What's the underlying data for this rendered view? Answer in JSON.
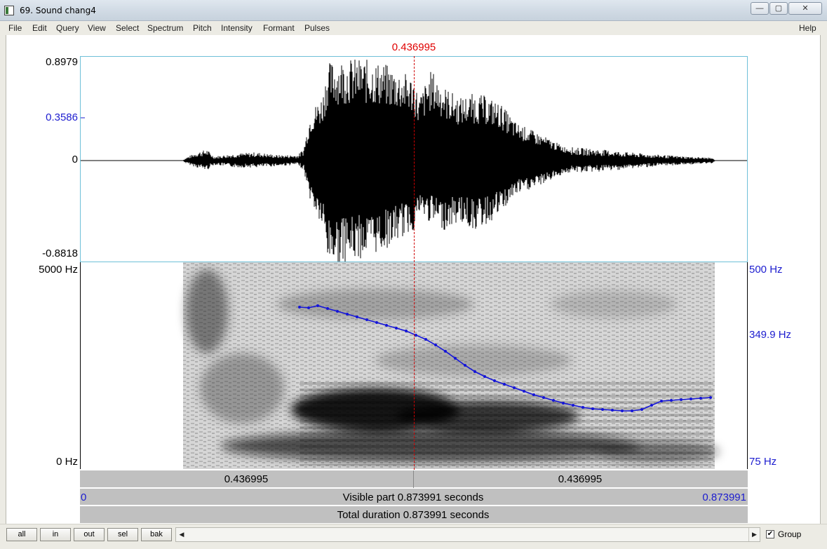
{
  "window": {
    "title": "69. Sound chang4",
    "min_glyph": "—",
    "max_glyph": "▢",
    "close_glyph": "✕"
  },
  "menu": {
    "items": [
      "File",
      "Edit",
      "Query",
      "View",
      "Select",
      "Spectrum",
      "Pitch",
      "Intensity",
      "Formant",
      "Pulses"
    ],
    "help": "Help"
  },
  "cursor": {
    "time_label": "0.436995"
  },
  "waveform": {
    "y_max": "0.8979",
    "y_value": "0.3586",
    "y_zero": "0",
    "y_min": "-0.8818"
  },
  "spectrogram": {
    "freq_max": "5000 Hz",
    "freq_min": "0 Hz"
  },
  "pitch": {
    "max": "500 Hz",
    "value": "349.9 Hz",
    "min": "75 Hz",
    "color": "#1515d8"
  },
  "timebars": {
    "left_segment": "0.436995",
    "right_segment": "0.436995",
    "visible_start": "0",
    "visible_label": "Visible part 0.873991 seconds",
    "visible_end": "0.873991",
    "total_label": "Total duration 0.873991 seconds"
  },
  "toolbar": {
    "buttons": [
      "all",
      "in",
      "out",
      "sel",
      "bak"
    ],
    "group_label": "Group",
    "group_checked": true,
    "check_glyph": "✔",
    "scroll_left_glyph": "◀",
    "scroll_right_glyph": "▶"
  }
}
